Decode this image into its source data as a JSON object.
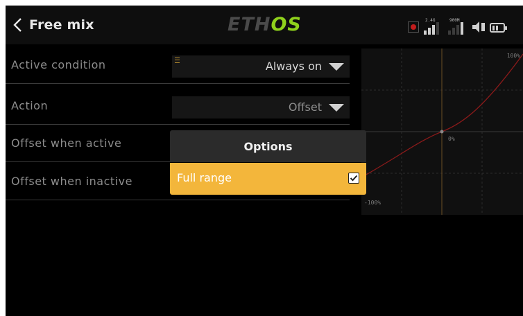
{
  "header": {
    "title": "Free mix",
    "logo_a": "ETH",
    "logo_b": "OS",
    "rf_label": "2.4G",
    "rf2_label": "900M",
    "brand_green": "#8fd11c"
  },
  "rows": [
    {
      "label": "Active condition",
      "value": "Always on",
      "value_color": "#d8d8d8"
    },
    {
      "label": "Action",
      "value": "Offset",
      "value_color": "#8c8c8c"
    },
    {
      "label": "Offset when active"
    },
    {
      "label": "Offset when inactive"
    }
  ],
  "curve": {
    "top_label": "100%",
    "mid_label": "0%",
    "bottom_label": "-100%",
    "curve_color": "#8b1a1a"
  },
  "popup": {
    "title": "Options",
    "option_label": "Full range",
    "option_checked": true,
    "accent": "#f3b63b"
  }
}
